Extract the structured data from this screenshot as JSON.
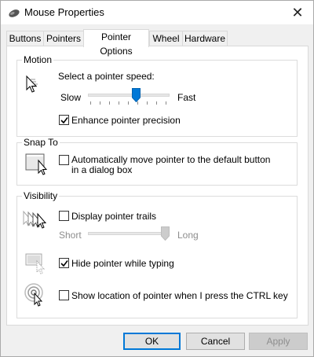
{
  "window": {
    "title": "Mouse Properties",
    "close_glyph": "✕"
  },
  "tabs": [
    {
      "label": "Buttons"
    },
    {
      "label": "Pointers"
    },
    {
      "label": "Pointer Options",
      "active": true
    },
    {
      "label": "Wheel"
    },
    {
      "label": "Hardware"
    }
  ],
  "motion": {
    "heading": "Motion",
    "speed_label": "Select a pointer speed:",
    "slow_label": "Slow",
    "fast_label": "Fast",
    "speed_level": 0.6,
    "precision_label": "Enhance pointer precision",
    "precision_checked": true,
    "icon": "pointer-speed-icon"
  },
  "snap_to": {
    "heading": "Snap To",
    "label": "Automatically move pointer to the default button in a dialog box",
    "checked": false,
    "icon": "snap-to-button-icon"
  },
  "visibility": {
    "heading": "Visibility",
    "trails_label": "Display pointer trails",
    "trails_checked": false,
    "short_label": "Short",
    "long_label": "Long",
    "trail_level": 1.0,
    "hide_label": "Hide pointer while typing",
    "hide_checked": true,
    "ctrl_label": "Show location of pointer when I press the CTRL key",
    "ctrl_checked": false,
    "trails_icon": "pointer-trails-icon",
    "hide_icon": "hide-pointer-icon",
    "ctrl_icon": "pointer-location-icon"
  },
  "buttons": {
    "ok": "OK",
    "cancel": "Cancel",
    "apply": "Apply"
  },
  "colors": {
    "accent": "#0078d7",
    "disabled_text": "#8d8d8d"
  }
}
